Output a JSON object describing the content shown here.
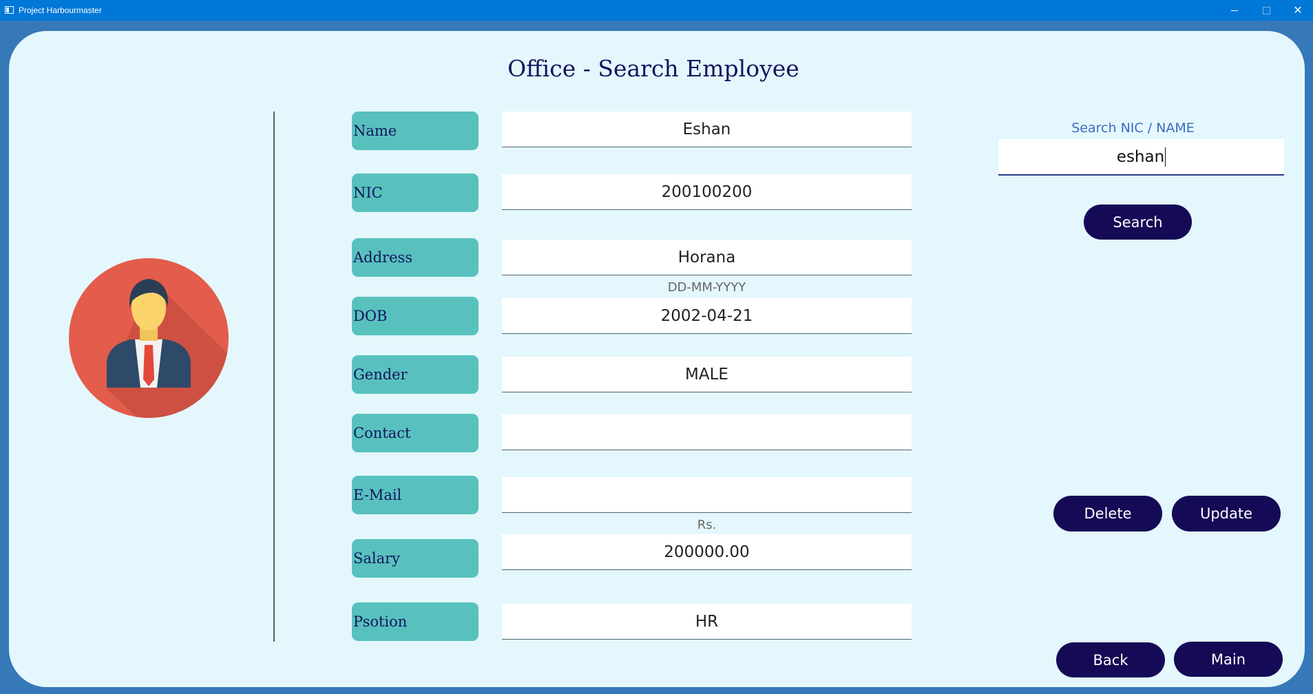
{
  "window": {
    "title": "Project Harbourmaster"
  },
  "page": {
    "title": "Office - Search Employee"
  },
  "form": {
    "fields": [
      {
        "label": "Name",
        "value": "Eshan"
      },
      {
        "label": "NIC",
        "value": "200100200"
      },
      {
        "label": "Address",
        "value": "Horana"
      },
      {
        "label": "DOB",
        "value": "2002-04-21",
        "hint": "DD-MM-YYYY"
      },
      {
        "label": "Gender",
        "value": "MALE"
      },
      {
        "label": "Contact",
        "value": ""
      },
      {
        "label": "E-Mail",
        "value": ""
      },
      {
        "label": "Salary",
        "value": "200000.00",
        "hint": "Rs."
      },
      {
        "label": "Psotion",
        "value": "HR"
      }
    ]
  },
  "search": {
    "label": "Search NIC / NAME",
    "value": "eshan",
    "button": "Search"
  },
  "actions": {
    "delete": "Delete",
    "update": "Update",
    "back": "Back",
    "main": "Main"
  },
  "colors": {
    "title_bar": "#0078d7",
    "panel": "#e4f7fc",
    "label_bg": "#58c1be",
    "button_bg": "#150a55",
    "heading_text": "#14145e"
  },
  "icons": {
    "avatar": "businessman-avatar-icon"
  }
}
